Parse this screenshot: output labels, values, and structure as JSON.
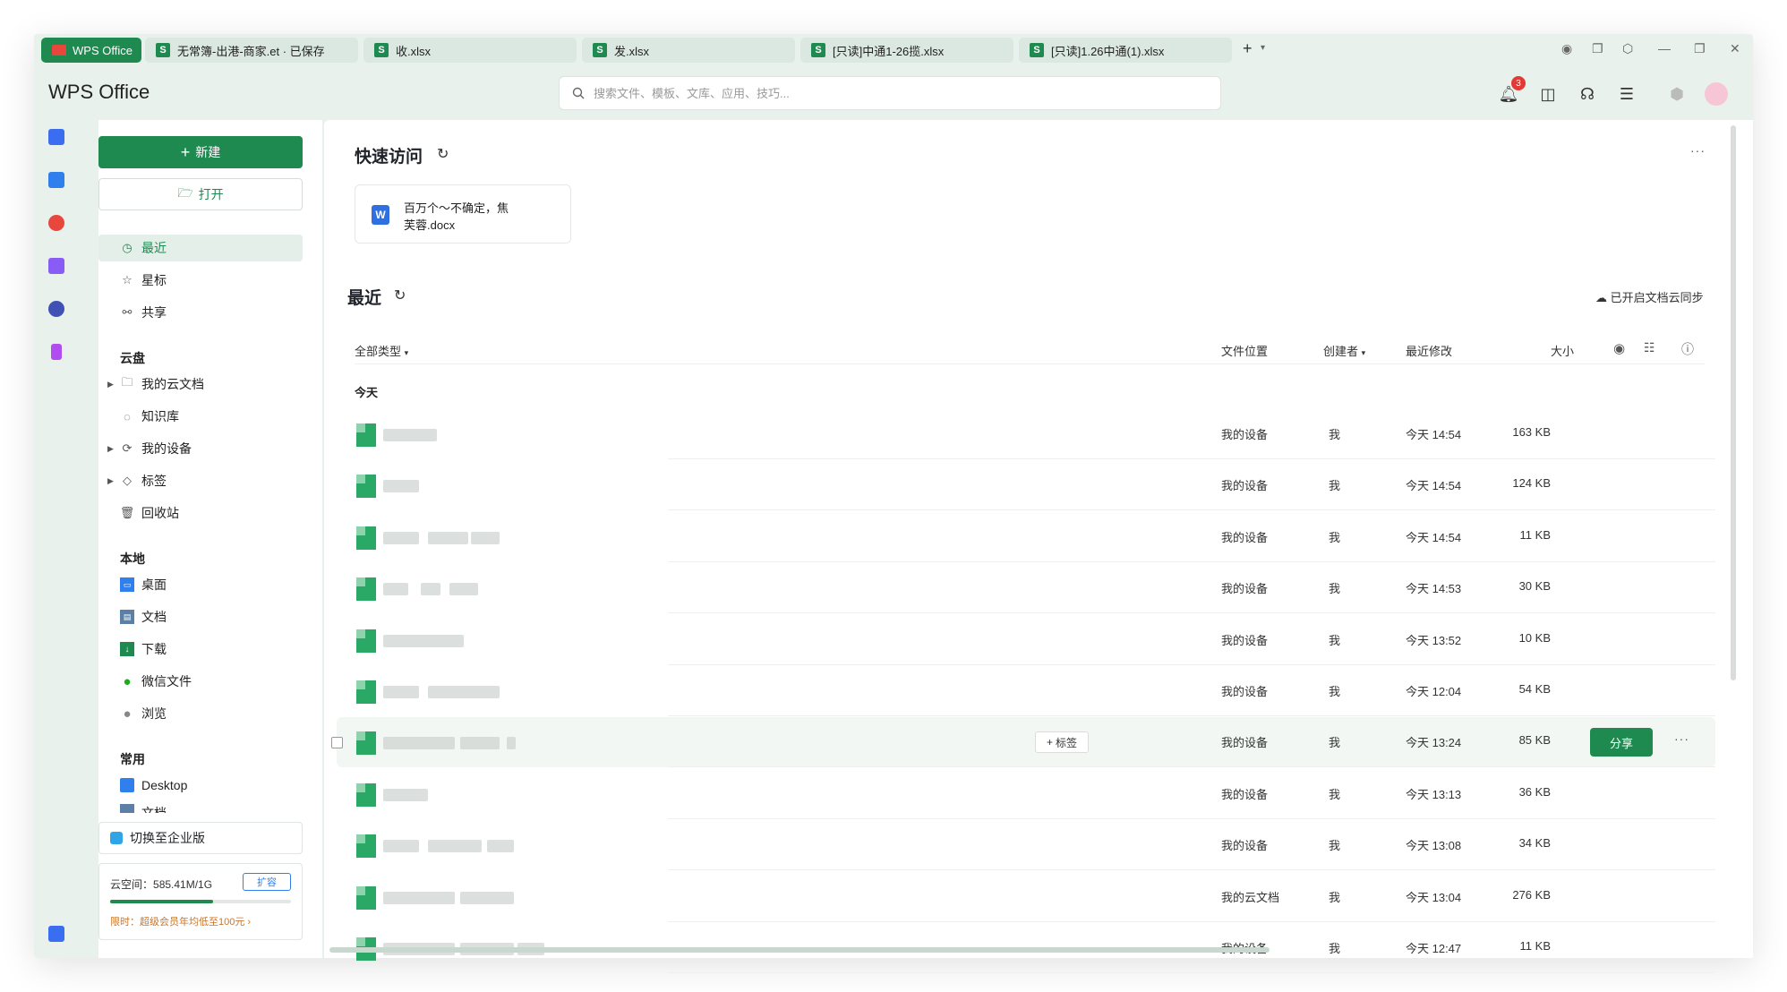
{
  "tabs": [
    {
      "label": "WPS Office",
      "type": "app"
    },
    {
      "label": "无常簿-出港-商家.et · 已保存",
      "icon": "S"
    },
    {
      "label": "收.xlsx",
      "icon": "S"
    },
    {
      "label": "发.xlsx",
      "icon": "S"
    },
    {
      "label": "[只读]中通1-26揽.xlsx",
      "icon": "S"
    },
    {
      "label": "[只读]1.26中通(1).xlsx",
      "icon": "S"
    }
  ],
  "tab_add": "+",
  "brand": "WPS Office",
  "search": {
    "placeholder": "搜索文件、模板、文库、应用、技巧..."
  },
  "notifications_count": "3",
  "sidebar": {
    "new_label": "新建",
    "open_label": "打开",
    "items": [
      {
        "label": "最近"
      },
      {
        "label": "星标"
      },
      {
        "label": "共享"
      }
    ],
    "cloud_title": "云盘",
    "cloud_items": [
      {
        "label": "我的云文档"
      },
      {
        "label": "知识库"
      },
      {
        "label": "我的设备"
      },
      {
        "label": "标签"
      },
      {
        "label": "回收站"
      }
    ],
    "local_title": "本地",
    "local_items": [
      {
        "label": "桌面"
      },
      {
        "label": "文档"
      },
      {
        "label": "下载"
      },
      {
        "label": "微信文件"
      },
      {
        "label": "浏览"
      }
    ],
    "common_title": "常用",
    "common_items": [
      {
        "label": "Desktop"
      },
      {
        "label": "文档"
      }
    ],
    "switch_label": "切换至企业版",
    "cloud_space_label": "云空间：",
    "cloud_space_value": "585.41M/1G",
    "cloud_space_fraction": 0.57,
    "expand_label": "扩容",
    "promo": "限时：超级会员年均低至100元 ›"
  },
  "main": {
    "quick_access_title": "快速访问",
    "quick_file_line1": "百万个～不确定，焦",
    "quick_file_line2": "芙蓉.docx",
    "recent_title": "最近",
    "sync_label": "已开启文档云同步",
    "filter_label": "全部类型",
    "col_location": "文件位置",
    "col_creator": "创建者",
    "col_modified": "最近修改",
    "col_size": "大小",
    "group_today": "今天",
    "tag_label": "标签",
    "share_label": "分享",
    "more": "···"
  },
  "rows": [
    {
      "location": "我的设备",
      "creator": "我",
      "modified": "今天 14:54",
      "size": "163 KB"
    },
    {
      "location": "我的设备",
      "creator": "我",
      "modified": "今天 14:54",
      "size": "124 KB"
    },
    {
      "location": "我的设备",
      "creator": "我",
      "modified": "今天 14:54",
      "size": "11 KB"
    },
    {
      "location": "我的设备",
      "creator": "我",
      "modified": "今天 14:53",
      "size": "30 KB"
    },
    {
      "location": "我的设备",
      "creator": "我",
      "modified": "今天 13:52",
      "size": "10 KB"
    },
    {
      "location": "我的设备",
      "creator": "我",
      "modified": "今天 12:04",
      "size": "54 KB"
    },
    {
      "location": "我的设备",
      "creator": "我",
      "modified": "今天 13:24",
      "size": "85 KB"
    },
    {
      "location": "我的设备",
      "creator": "我",
      "modified": "今天 13:13",
      "size": "36 KB"
    },
    {
      "location": "我的设备",
      "creator": "我",
      "modified": "今天 13:08",
      "size": "34 KB"
    },
    {
      "location": "我的云文档",
      "creator": "我",
      "modified": "今天 13:04",
      "size": "276 KB"
    },
    {
      "location": "我的设备",
      "creator": "我",
      "modified": "今天 12:47",
      "size": "11 KB"
    }
  ]
}
